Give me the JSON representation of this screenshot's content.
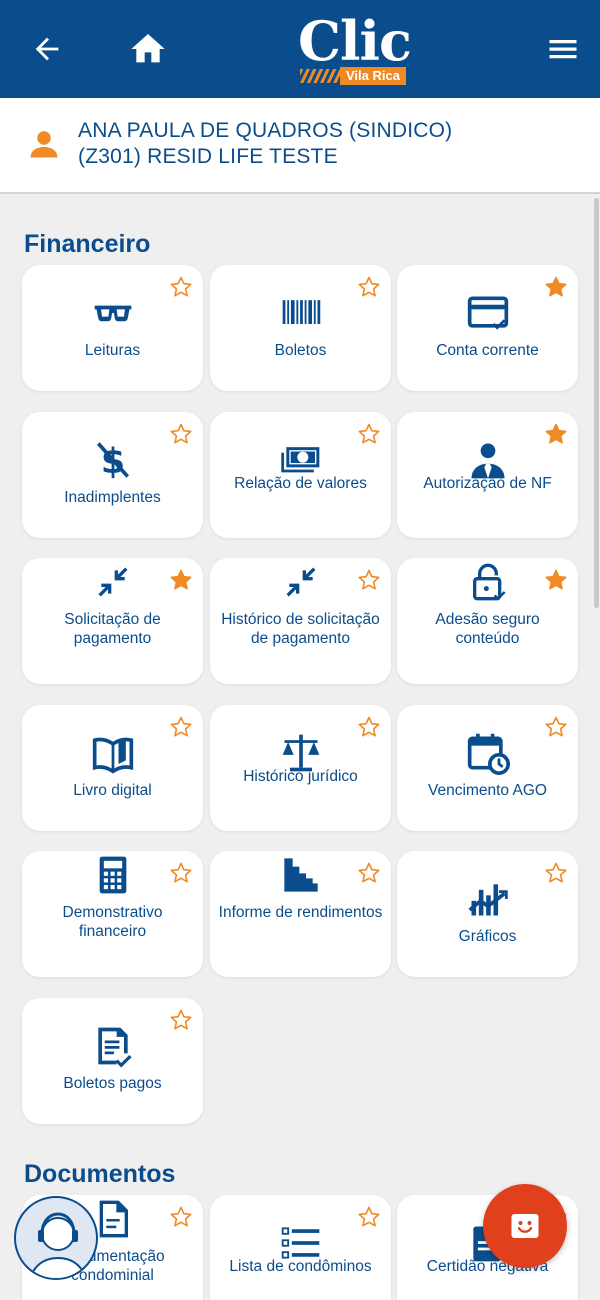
{
  "header": {
    "logo_main": "Clic",
    "logo_sub": "Vila Rica"
  },
  "user": {
    "line1": "ANA PAULA DE QUADROS (SINDICO)",
    "line2": "(Z301) RESID LIFE TESTE"
  },
  "sections": {
    "financeiro": "Financeiro",
    "documentos": "Documentos"
  },
  "cards": [
    {
      "label": "Leituras",
      "icon": "glasses-icon",
      "starred": false
    },
    {
      "label": "Boletos",
      "icon": "barcode-icon",
      "starred": false
    },
    {
      "label": "Conta corrente",
      "icon": "credit-card-icon",
      "starred": true
    },
    {
      "label": "Inadimplentes",
      "icon": "no-money-icon",
      "starred": false
    },
    {
      "label": "Relação de valores",
      "icon": "money-bill-icon",
      "starred": false
    },
    {
      "label": "Autorização de NF",
      "icon": "manager-icon",
      "starred": true
    },
    {
      "label": "Solicitação de pagamento",
      "icon": "collapse-arrows-icon",
      "starred": true
    },
    {
      "label": "Histórico de solicitação de pagamento",
      "icon": "collapse-arrows-icon",
      "starred": false
    },
    {
      "label": "Adesão seguro conteúdo",
      "icon": "lock-check-icon",
      "starred": true
    },
    {
      "label": "Livro digital",
      "icon": "book-icon",
      "starred": false
    },
    {
      "label": "Histórico jurídico",
      "icon": "scales-icon",
      "starred": false
    },
    {
      "label": "Vencimento AGO",
      "icon": "calendar-clock-icon",
      "starred": false
    },
    {
      "label": "Demonstrativo financeiro",
      "icon": "calculator-icon",
      "starred": false
    },
    {
      "label": "Informe de rendimentos",
      "icon": "stairs-chart-icon",
      "starred": false
    },
    {
      "label": "Gráficos",
      "icon": "bar-trend-icon",
      "starred": false
    },
    {
      "label": "Boletos pagos",
      "icon": "document-check-icon",
      "starred": false
    }
  ],
  "doc_cards": [
    {
      "label": "Documentação condominial",
      "icon": "document-icon",
      "starred": false
    },
    {
      "label": "Lista de condôminos",
      "icon": "list-icon",
      "starred": false
    },
    {
      "label": "Certidão negativa",
      "icon": "certificate-icon",
      "starred": false
    }
  ],
  "colors": {
    "primary": "#0b4d8c",
    "accent": "#f08a24",
    "fab": "#e0401c",
    "background": "#efeff0"
  }
}
